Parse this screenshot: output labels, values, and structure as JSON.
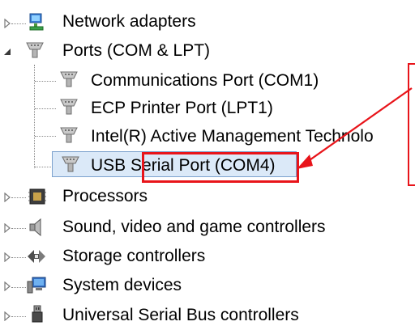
{
  "tree": {
    "items": [
      {
        "label": "Network adapters",
        "icon": "network-adapter-icon",
        "expanded": false
      },
      {
        "label": "Ports (COM & LPT)",
        "icon": "port-icon",
        "expanded": true
      },
      {
        "label": "Communications Port (COM1)",
        "icon": "port-icon"
      },
      {
        "label": "ECP Printer Port (LPT1)",
        "icon": "port-icon"
      },
      {
        "label": "Intel(R) Active Management Technolo",
        "icon": "port-icon"
      },
      {
        "label": "USB Serial Port (COM4)",
        "icon": "port-icon",
        "selected": true
      },
      {
        "label": "Processors",
        "icon": "processor-icon",
        "expanded": false
      },
      {
        "label": "Sound, video and game controllers",
        "icon": "speaker-icon",
        "expanded": false
      },
      {
        "label": "Storage controllers",
        "icon": "storage-icon",
        "expanded": false
      },
      {
        "label": "System devices",
        "icon": "system-devices-icon",
        "expanded": false
      },
      {
        "label": "Universal Serial Bus controllers",
        "icon": "usb-icon",
        "expanded": false
      }
    ]
  },
  "annotation": {
    "highlight_color": "#e8141a",
    "selection_color": "#dbe9f8"
  }
}
